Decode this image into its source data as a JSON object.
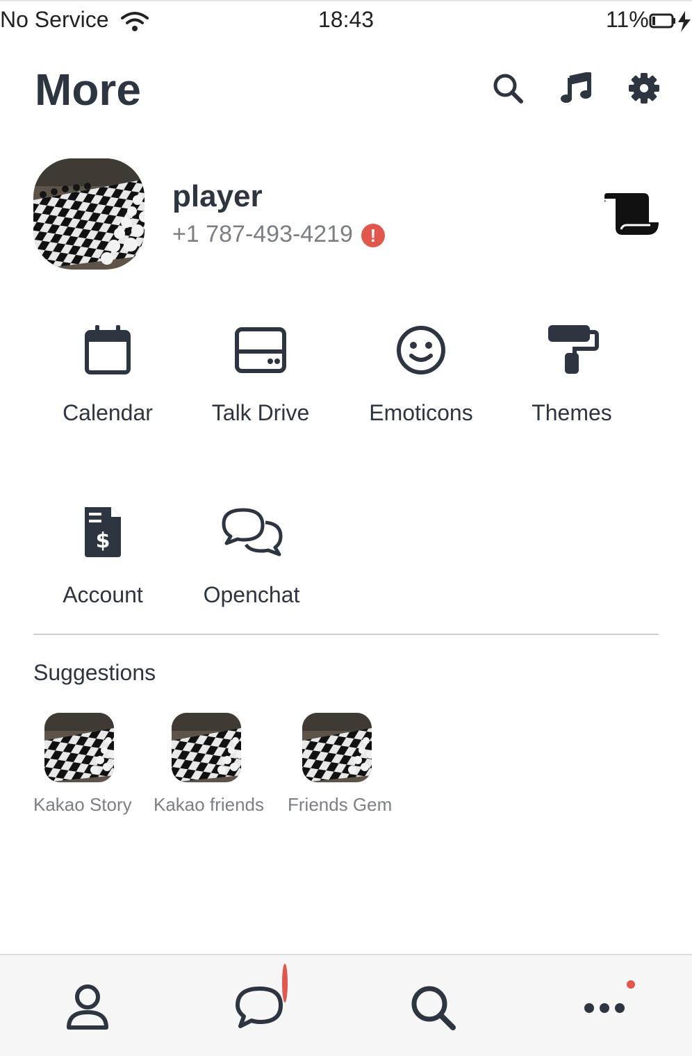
{
  "status_bar": {
    "carrier": "No Service",
    "time": "18:43",
    "battery": "11%"
  },
  "header": {
    "title": "More",
    "icons": [
      "search-icon",
      "music-icon",
      "gear-icon"
    ]
  },
  "profile": {
    "name": "player",
    "phone": "+1 787-493-4219",
    "alert": "!",
    "right_icon": "scroll-icon"
  },
  "menu": [
    {
      "label": "Calendar",
      "icon": "calendar-icon"
    },
    {
      "label": "Talk Drive",
      "icon": "drive-icon"
    },
    {
      "label": "Emoticons",
      "icon": "smile-icon"
    },
    {
      "label": "Themes",
      "icon": "paint-roller-icon"
    },
    {
      "label": "Account",
      "icon": "invoice-icon"
    },
    {
      "label": "Openchat",
      "icon": "chat-bubbles-icon"
    }
  ],
  "suggestions": {
    "title": "Suggestions",
    "items": [
      {
        "label": "Kakao Story"
      },
      {
        "label": "Kakao friends"
      },
      {
        "label": "Friends Gem"
      }
    ]
  },
  "tab_bar": {
    "tabs": [
      "person-icon",
      "chat-icon",
      "search-icon",
      "more-icon"
    ]
  },
  "colors": {
    "text": "#2d3540",
    "muted": "#7b7f84",
    "accent": "#e2574c"
  }
}
